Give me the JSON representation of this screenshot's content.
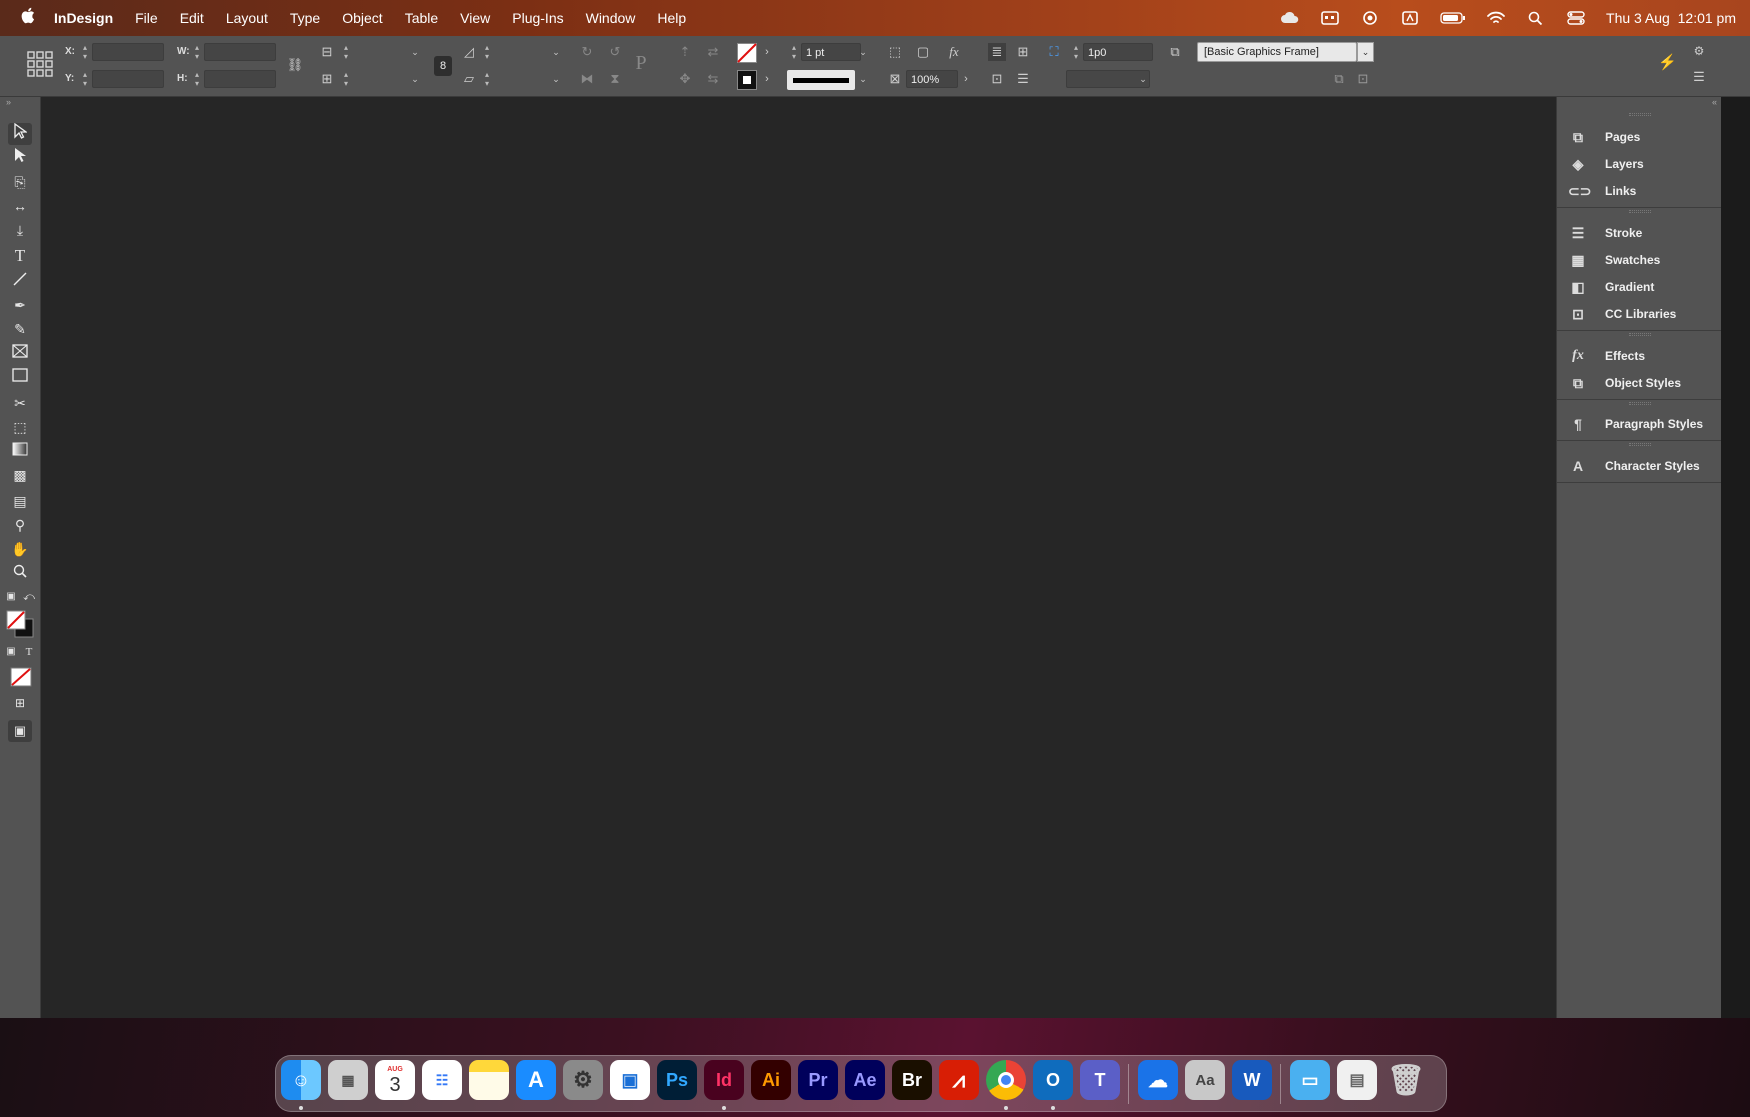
{
  "menubar": {
    "app_name": "InDesign",
    "items": [
      "File",
      "Edit",
      "Layout",
      "Type",
      "Object",
      "Table",
      "View",
      "Plug-Ins",
      "Window",
      "Help"
    ],
    "clock": "Thu 3 Aug  12:01 pm"
  },
  "controlbar": {
    "x_label": "X:",
    "y_label": "Y:",
    "w_label": "W:",
    "h_label": "H:",
    "stroke_weight": "1 pt",
    "opacity": "100%",
    "offset": "1p0",
    "object_style": "[Basic Graphics Frame]"
  },
  "tools": [
    "selection",
    "direct-selection",
    "page",
    "gap",
    "content-collector",
    "type",
    "line",
    "pen",
    "pencil",
    "rectangle-frame",
    "rectangle",
    "scissors",
    "free-transform",
    "gradient-swatch",
    "gradient-feather",
    "note",
    "eyedropper",
    "hand",
    "zoom"
  ],
  "panels": [
    {
      "label": "Pages",
      "icon": "pages-icon"
    },
    {
      "label": "Layers",
      "icon": "layers-icon"
    },
    {
      "label": "Links",
      "icon": "links-icon"
    },
    {
      "label": "Stroke",
      "icon": "stroke-icon"
    },
    {
      "label": "Swatches",
      "icon": "swatches-icon"
    },
    {
      "label": "Gradient",
      "icon": "gradient-icon"
    },
    {
      "label": "CC Libraries",
      "icon": "cc-libraries-icon"
    },
    {
      "label": "Effects",
      "icon": "effects-icon"
    },
    {
      "label": "Object Styles",
      "icon": "object-styles-icon"
    },
    {
      "label": "Paragraph Styles",
      "icon": "paragraph-styles-icon"
    },
    {
      "label": "Character Styles",
      "icon": "character-styles-icon"
    }
  ],
  "dock": {
    "calendar_month": "AUG",
    "calendar_day": "3",
    "apps": [
      {
        "label": "Ps",
        "name": "photoshop",
        "bg": "#001e36",
        "fg": "#31a8ff"
      },
      {
        "label": "Id",
        "name": "indesign",
        "bg": "#49021f",
        "fg": "#ff3366"
      },
      {
        "label": "Ai",
        "name": "illustrator",
        "bg": "#330000",
        "fg": "#ff9a00"
      },
      {
        "label": "Pr",
        "name": "premiere",
        "bg": "#00005b",
        "fg": "#9999ff"
      },
      {
        "label": "Ae",
        "name": "after-effects",
        "bg": "#00005b",
        "fg": "#9999ff"
      },
      {
        "label": "Br",
        "name": "bridge",
        "bg": "#1a0f00",
        "fg": "#ffffff"
      }
    ]
  }
}
